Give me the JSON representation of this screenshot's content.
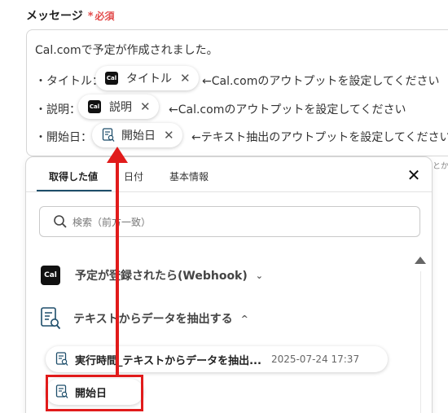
{
  "field": {
    "label": "メッセージ",
    "required_mark": "*",
    "required_text": "必須"
  },
  "message": {
    "line1": "Cal.comで予定が作成されました。",
    "rows": [
      {
        "prefix": "・タイトル：",
        "chip_label": "タイトル",
        "chip_icon": "cal-icon",
        "hint": "←Cal.comのアウトプットを設定してください"
      },
      {
        "prefix": "・説明：",
        "chip_label": "説明",
        "chip_icon": "cal-icon",
        "hint": "←Cal.comのアウトプットを設定してください"
      },
      {
        "prefix": "・開始日：",
        "chip_label": "開始日",
        "chip_icon": "document-search-icon",
        "hint": "←テキスト抽出のアウトプットを設定してください"
      }
    ],
    "cal_icon_text": "Cal",
    "remove_glyph": "✕"
  },
  "edge_text": "とか",
  "panel": {
    "tabs": [
      {
        "label": "取得した値",
        "active": true
      },
      {
        "label": "日付",
        "active": false
      },
      {
        "label": "基本情報",
        "active": false
      }
    ],
    "close_glyph": "✕",
    "search_placeholder": "検索（前方一致）",
    "sections": [
      {
        "icon": "cal-logo-icon",
        "icon_text": "Cal",
        "label": "予定が登録されたら(Webhook)",
        "chevron": "⌄"
      },
      {
        "icon": "document-search-icon",
        "label": "テキストからデータを抽出する",
        "chevron": "^"
      }
    ],
    "results": [
      {
        "label": "実行時間_テキストからデータを抽出...",
        "time": "2025-07-24 17:37"
      },
      {
        "label": "開始日"
      }
    ]
  },
  "colors": {
    "highlight_red": "#e11b1b",
    "required_red": "#e24c4c",
    "tab_underline": "#1e4e6b"
  }
}
